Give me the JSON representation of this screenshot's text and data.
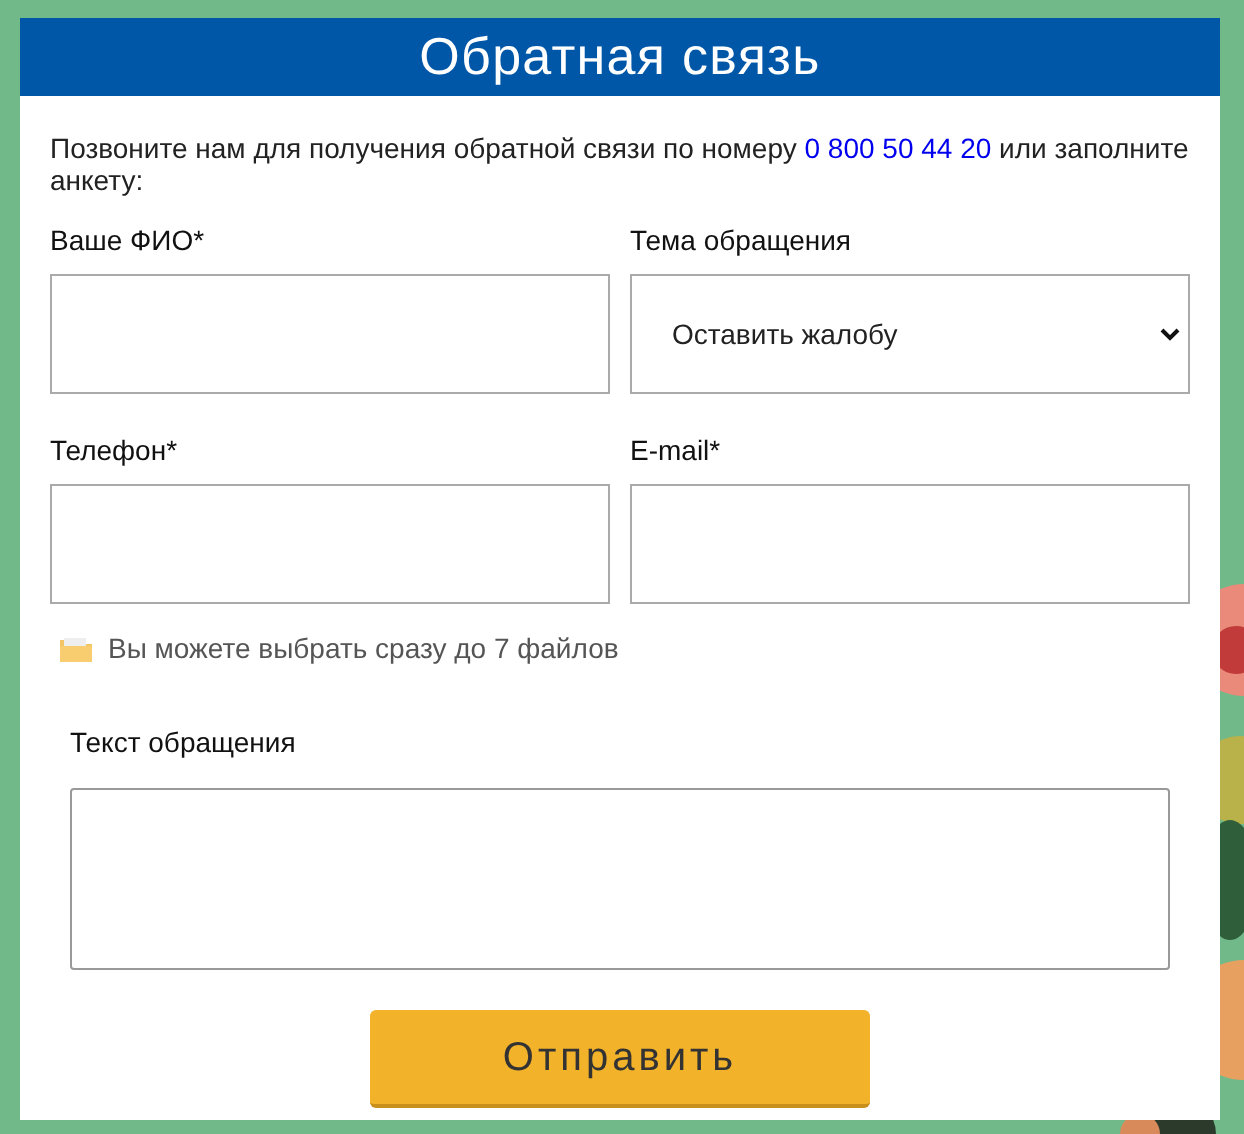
{
  "title": "Обратная связь",
  "intro": {
    "before": "Позвоните нам для получения обратной связи по номеру ",
    "phone": "0 800 50 44 20",
    "after": " или заполните анкету:"
  },
  "fields": [
    {
      "kind": "input",
      "label": "Ваше ФИО*"
    },
    {
      "kind": "select",
      "label": "Тема обращения",
      "value": "Оставить жалобу"
    },
    {
      "kind": "input",
      "label": "Телефон*"
    },
    {
      "kind": "input",
      "label": "E-mail*"
    }
  ],
  "files_hint": "Вы можете выбрать сразу до 7 файлов",
  "message": {
    "label": "Текст обращения"
  },
  "submit": "Отправить"
}
